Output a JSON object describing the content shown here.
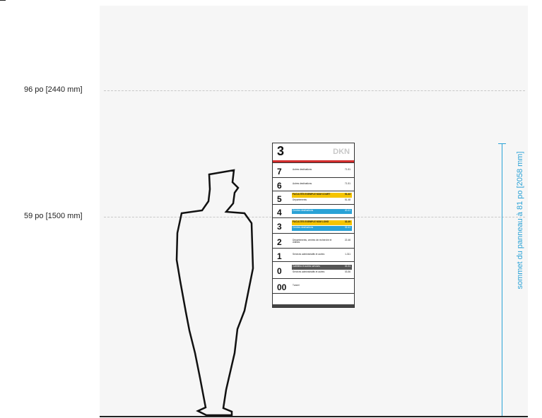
{
  "levels": [
    {
      "label": "96 po [2440 mm]"
    },
    {
      "label": "59 po [1500 mm]"
    }
  ],
  "dimension": {
    "label": "sommet du panneau à 81 po [2058 mm]"
  },
  "sign": {
    "floor": "3",
    "code": "DKN",
    "rows": [
      {
        "floor": "7",
        "entries": [
          {
            "text": "Autres destinations",
            "code": "71-51",
            "style": "plain"
          }
        ]
      },
      {
        "floor": "6",
        "entries": [
          {
            "text": "Autres destinations",
            "code": "71-51",
            "style": "plain"
          }
        ]
      },
      {
        "floor": "5",
        "entries": [
          {
            "text": "FACULTÉS EXEMPLE NOM COURT",
            "code": "51-43",
            "style": "yellow"
          },
          {
            "text": "Départements",
            "code": "51-48",
            "style": "plain"
          }
        ]
      },
      {
        "floor": "4",
        "entries": [
          {
            "text": "Centres destinations",
            "code": "40-41",
            "style": "blue"
          }
        ]
      },
      {
        "floor": "3",
        "entries": [
          {
            "text": "FACULTÉS EXEMPLE NOM LONG",
            "code": "32-49",
            "style": "yellow"
          },
          {
            "text": "Centres destinations",
            "code": "32-41",
            "style": "blue"
          }
        ]
      },
      {
        "floor": "2",
        "entries": [
          {
            "text": "Départements, centres de recherche et chaires",
            "code": "22-46",
            "style": "plain"
          }
        ]
      },
      {
        "floor": "1",
        "entries": [
          {
            "text": "Services administratifs et autres",
            "code": "1-311",
            "style": "plain"
          }
        ]
      },
      {
        "floor": "0",
        "entries": [
          {
            "text": "Cafétéria et autres services",
            "code": "02-31",
            "style": "dark"
          },
          {
            "text": "Services administratifs et autres",
            "code": "03-56",
            "style": "plain"
          }
        ]
      },
      {
        "floor": "00",
        "entries": [
          {
            "text": "Tunnel",
            "code": "",
            "style": "plain"
          }
        ]
      }
    ]
  },
  "colors": {
    "accent": "#2aa2d6",
    "red": "#d22d2d",
    "yellow": "#f5c400"
  }
}
